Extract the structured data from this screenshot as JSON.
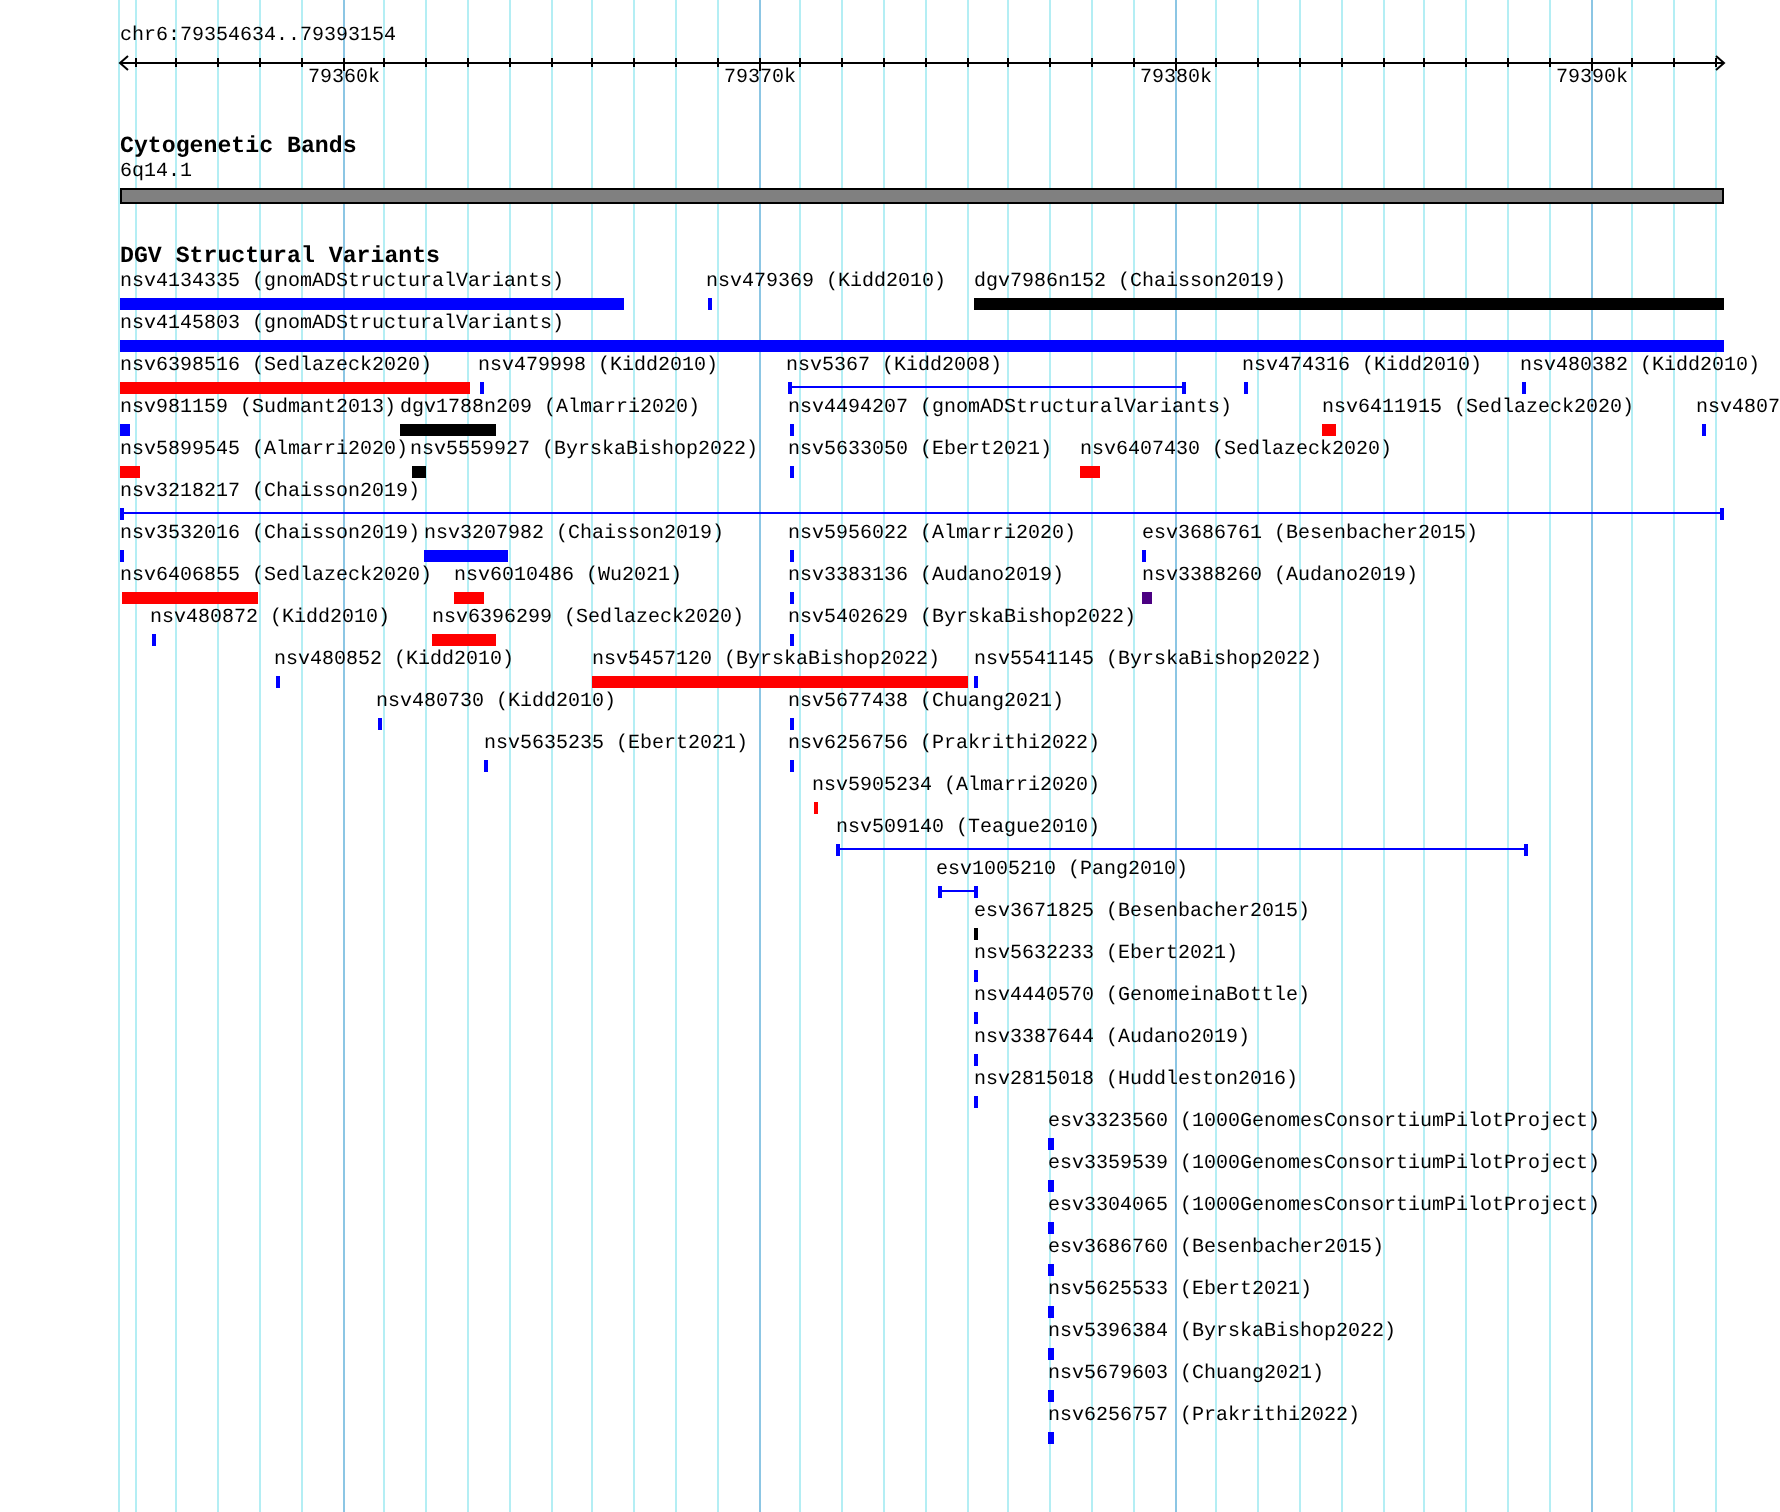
{
  "location": "chr6:79354634..79393154",
  "ruler": {
    "ticks": [
      "79360k",
      "79370k",
      "79380k",
      "79390k"
    ]
  },
  "cytoband_track": {
    "title": "Cytogenetic Bands",
    "band": "6q14.1"
  },
  "dgv_track": {
    "title": "DGV Structural Variants",
    "features": [
      {
        "label": "nsv4134335 (gnomADStructuralVariants)",
        "kind": "bar",
        "color": "#0000ff"
      },
      {
        "label": "nsv479369 (Kidd2010)",
        "kind": "bar",
        "color": "#0000ff"
      },
      {
        "label": "dgv7986n152 (Chaisson2019)",
        "kind": "bar",
        "color": "#000000"
      },
      {
        "label": "nsv4145803 (gnomADStructuralVariants)",
        "kind": "bar",
        "color": "#0000ff"
      },
      {
        "label": "nsv6398516 (Sedlazeck2020)",
        "kind": "bar",
        "color": "#ff0000"
      },
      {
        "label": "nsv479998 (Kidd2010)",
        "kind": "bar",
        "color": "#0000ff"
      },
      {
        "label": "nsv5367 (Kidd2008)",
        "kind": "span",
        "color": "#0000ff"
      },
      {
        "label": "nsv474316 (Kidd2010)",
        "kind": "bar",
        "color": "#0000ff"
      },
      {
        "label": "nsv480382 (Kidd2010)",
        "kind": "bar",
        "color": "#0000ff"
      },
      {
        "label": "nsv981159 (Sudmant2013)",
        "kind": "bar",
        "color": "#0000ff"
      },
      {
        "label": "dgv1788n209 (Almarri2020)",
        "kind": "bar",
        "color": "#000000"
      },
      {
        "label": "nsv4494207 (gnomADStructuralVariants)",
        "kind": "bar",
        "color": "#0000ff"
      },
      {
        "label": "nsv6411915 (Sedlazeck2020)",
        "kind": "bar",
        "color": "#ff0000"
      },
      {
        "label": "nsv4807",
        "kind": "bar",
        "color": "#0000ff"
      },
      {
        "label": "nsv5899545 (Almarri2020)",
        "kind": "bar",
        "color": "#ff0000"
      },
      {
        "label": "nsv5559927 (ByrskaBishop2022)",
        "kind": "bar",
        "color": "#000000"
      },
      {
        "label": "nsv5633050 (Ebert2021)",
        "kind": "bar",
        "color": "#0000ff"
      },
      {
        "label": "nsv6407430 (Sedlazeck2020)",
        "kind": "bar",
        "color": "#ff0000"
      },
      {
        "label": "nsv3218217 (Chaisson2019)",
        "kind": "span",
        "color": "#0000ff"
      },
      {
        "label": "nsv3532016 (Chaisson2019)",
        "kind": "bar",
        "color": "#0000ff"
      },
      {
        "label": "nsv3207982 (Chaisson2019)",
        "kind": "bar",
        "color": "#0000ff"
      },
      {
        "label": "nsv5956022 (Almarri2020)",
        "kind": "bar",
        "color": "#0000ff"
      },
      {
        "label": "esv3686761 (Besenbacher2015)",
        "kind": "bar",
        "color": "#0000ff"
      },
      {
        "label": "nsv6406855 (Sedlazeck2020)",
        "kind": "bar",
        "color": "#ff0000"
      },
      {
        "label": "nsv6010486 (Wu2021)",
        "kind": "bar",
        "color": "#ff0000"
      },
      {
        "label": "nsv3383136 (Audano2019)",
        "kind": "bar",
        "color": "#0000ff"
      },
      {
        "label": "nsv3388260 (Audano2019)",
        "kind": "bar",
        "color": "#4b0082"
      },
      {
        "label": "nsv480872 (Kidd2010)",
        "kind": "bar",
        "color": "#0000ff"
      },
      {
        "label": "nsv6396299 (Sedlazeck2020)",
        "kind": "bar",
        "color": "#ff0000"
      },
      {
        "label": "nsv5402629 (ByrskaBishop2022)",
        "kind": "bar",
        "color": "#0000ff"
      },
      {
        "label": "nsv480852 (Kidd2010)",
        "kind": "bar",
        "color": "#0000ff"
      },
      {
        "label": "nsv5457120 (ByrskaBishop2022)",
        "kind": "bar",
        "color": "#ff0000"
      },
      {
        "label": "nsv5541145 (ByrskaBishop2022)",
        "kind": "bar",
        "color": "#0000ff"
      },
      {
        "label": "nsv480730 (Kidd2010)",
        "kind": "bar",
        "color": "#0000ff"
      },
      {
        "label": "nsv5677438 (Chuang2021)",
        "kind": "bar",
        "color": "#0000ff"
      },
      {
        "label": "nsv5635235 (Ebert2021)",
        "kind": "bar",
        "color": "#0000ff"
      },
      {
        "label": "nsv6256756 (Prakrithi2022)",
        "kind": "bar",
        "color": "#0000ff"
      },
      {
        "label": "nsv5905234 (Almarri2020)",
        "kind": "bar",
        "color": "#ff0000"
      },
      {
        "label": "nsv509140 (Teague2010)",
        "kind": "span",
        "color": "#0000ff"
      },
      {
        "label": "esv1005210 (Pang2010)",
        "kind": "span",
        "color": "#0000ff"
      },
      {
        "label": "esv3671825 (Besenbacher2015)",
        "kind": "bar",
        "color": "#000000"
      },
      {
        "label": "nsv5632233 (Ebert2021)",
        "kind": "bar",
        "color": "#0000ff"
      },
      {
        "label": "nsv4440570 (GenomeinaBottle)",
        "kind": "bar",
        "color": "#0000ff"
      },
      {
        "label": "nsv3387644 (Audano2019)",
        "kind": "bar",
        "color": "#0000ff"
      },
      {
        "label": "nsv2815018 (Huddleston2016)",
        "kind": "bar",
        "color": "#0000ff"
      },
      {
        "label": "esv3323560 (1000GenomesConsortiumPilotProject)",
        "kind": "bar",
        "color": "#0000ff"
      },
      {
        "label": "esv3359539 (1000GenomesConsortiumPilotProject)",
        "kind": "bar",
        "color": "#0000ff"
      },
      {
        "label": "esv3304065 (1000GenomesConsortiumPilotProject)",
        "kind": "bar",
        "color": "#0000ff"
      },
      {
        "label": "esv3686760 (Besenbacher2015)",
        "kind": "bar",
        "color": "#0000ff"
      },
      {
        "label": "nsv5625533 (Ebert2021)",
        "kind": "bar",
        "color": "#0000ff"
      },
      {
        "label": "nsv5396384 (ByrskaBishop2022)",
        "kind": "bar",
        "color": "#0000ff"
      },
      {
        "label": "nsv5679603 (Chuang2021)",
        "kind": "bar",
        "color": "#0000ff"
      },
      {
        "label": "nsv6256757 (Prakrithi2022)",
        "kind": "bar",
        "color": "#0000ff"
      }
    ]
  }
}
